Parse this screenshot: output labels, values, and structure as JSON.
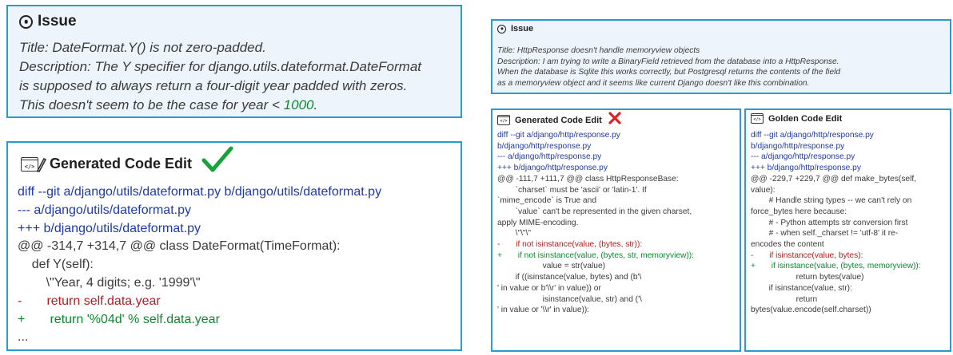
{
  "left": {
    "issue": {
      "title": "Issue",
      "line1": "Title: DateFormat.Y() is not zero-padded.",
      "desc_a": "Description: The Y specifier for django.utils.dateformat.DateFormat",
      "desc_b": "is supposed to always return a four-digit year padded with zeros.",
      "desc_c_prefix": "This doesn't seem to be the case for year < ",
      "desc_c_num": "1000",
      "desc_c_suffix": ".",
      "icon": "target-icon"
    },
    "edit": {
      "title": "Generated Code Edit",
      "status": "check-icon",
      "lines": [
        "diff --git a/django/utils/dateformat.py b/django/utils/dateformat.py",
        "--- a/django/utils/dateformat.py",
        "+++ b/django/utils/dateformat.py",
        "@@ -314,7 +314,7 @@ class DateFormat(TimeFormat):",
        "    def Y(self):",
        "        \\\"Year, 4 digits; e.g. '1999'\\\"",
        "-       return self.data.year",
        "+       return '%04d' % self.data.year",
        "..."
      ]
    }
  },
  "right": {
    "issue": {
      "title": "Issue",
      "line1": "Title: HttpResponse doesn't handle memoryview objects",
      "desc1": "Description: I am trying to write a BinaryField retrieved from the database into a HttpResponse.",
      "desc2": "When the database is Sqlite this works correctly, but Postgresql returns the contents of the field",
      "desc3": "as a memoryview object and it seems like current Django doesn't like this combination."
    },
    "generated": {
      "title": "Generated Code Edit",
      "status": "cross-icon",
      "lines": [
        "diff --git a/django/http/response.py",
        "b/django/http/response.py",
        "--- a/django/http/response.py",
        "+++ b/django/http/response.py",
        "@@ -111,7 +111,7 @@ class HttpResponseBase:",
        "        `charset` must be 'ascii' or 'latin-1'. If",
        "`mime_encode` is True and",
        "        `value` can't be represented in the given charset,",
        "apply MIME-encoding.",
        "        \\\"\\\"\\\"",
        "-       if not isinstance(value, (bytes, str)):",
        "+       if not isinstance(value, (bytes, str, memoryview)):",
        "                    value = str(value)",
        "        if ((isinstance(value, bytes) and (b'\\",
        "' in value or b'\\\\r' in value)) or",
        "                    isinstance(value, str) and ('\\",
        "' in value or '\\\\r' in value)):"
      ]
    },
    "golden": {
      "title": "Golden Code Edit",
      "lines": [
        "diff --git a/django/http/response.py",
        "b/django/http/response.py",
        "--- a/django/http/response.py",
        "+++ b/django/http/response.py",
        "@@ -229,7 +229,7 @@ def make_bytes(self,",
        "value):",
        "        # Handle string types -- we can't rely on",
        "force_bytes here because:",
        "        # - Python attempts str conversion first",
        "        # - when self._charset != 'utf-8' it re-",
        "encodes the content",
        "-       if isinstance(value, bytes):",
        "+       if isinstance(value, (bytes, memoryview)):",
        "                    return bytes(value)",
        "        if isinstance(value, str):",
        "                    return",
        "bytes(value.encode(self.charset))"
      ]
    }
  }
}
